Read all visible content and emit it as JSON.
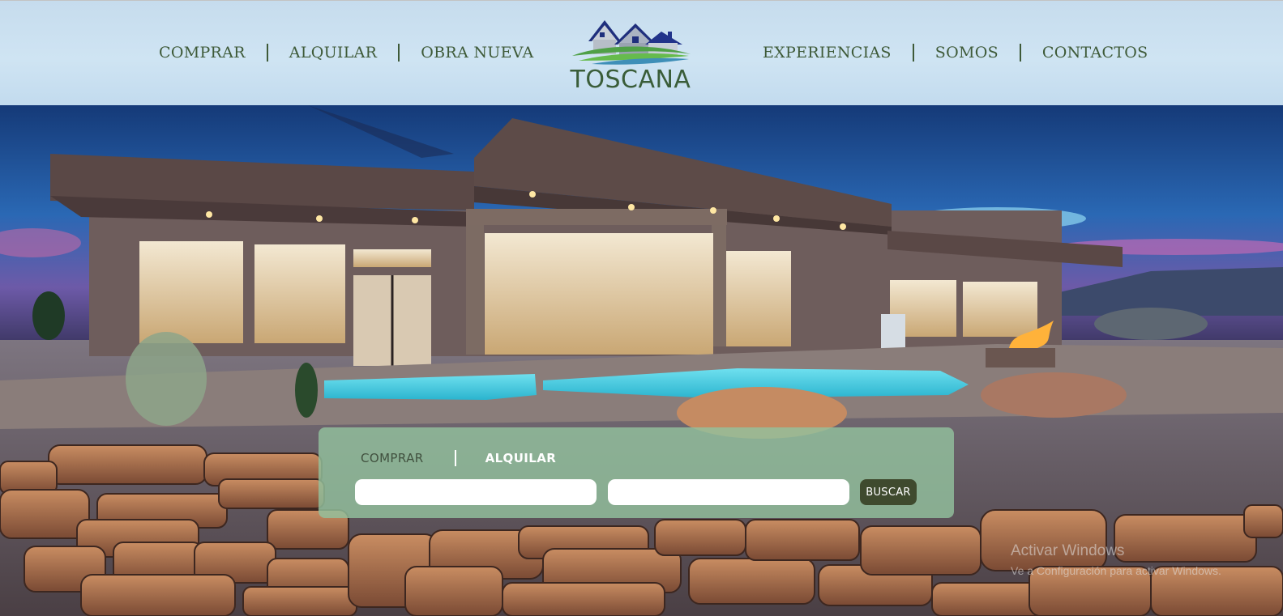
{
  "header": {
    "nav_left": [
      "COMPRAR",
      "ALQUILAR",
      "OBRA NUEVA"
    ],
    "nav_right": [
      "EXPERIENCIAS",
      "SOMOS",
      "CONTACTOS"
    ],
    "logo_text": "TOSCANA",
    "logo_icon": "houses-icon"
  },
  "search": {
    "tabs": [
      {
        "label": "COMPRAR",
        "active": false
      },
      {
        "label": "ALQUILAR",
        "active": true
      }
    ],
    "field1_placeholder": "",
    "field2_placeholder": "",
    "button_label": "BUSCAR"
  },
  "watermark": {
    "title": "Activar Windows",
    "subtitle": "Ve a Configuración para activar Windows."
  },
  "colors": {
    "nav_text": "#3e5a38",
    "logo_text": "#3a5d39",
    "search_panel": "#92c19e",
    "search_button": "#3f4a2e"
  }
}
